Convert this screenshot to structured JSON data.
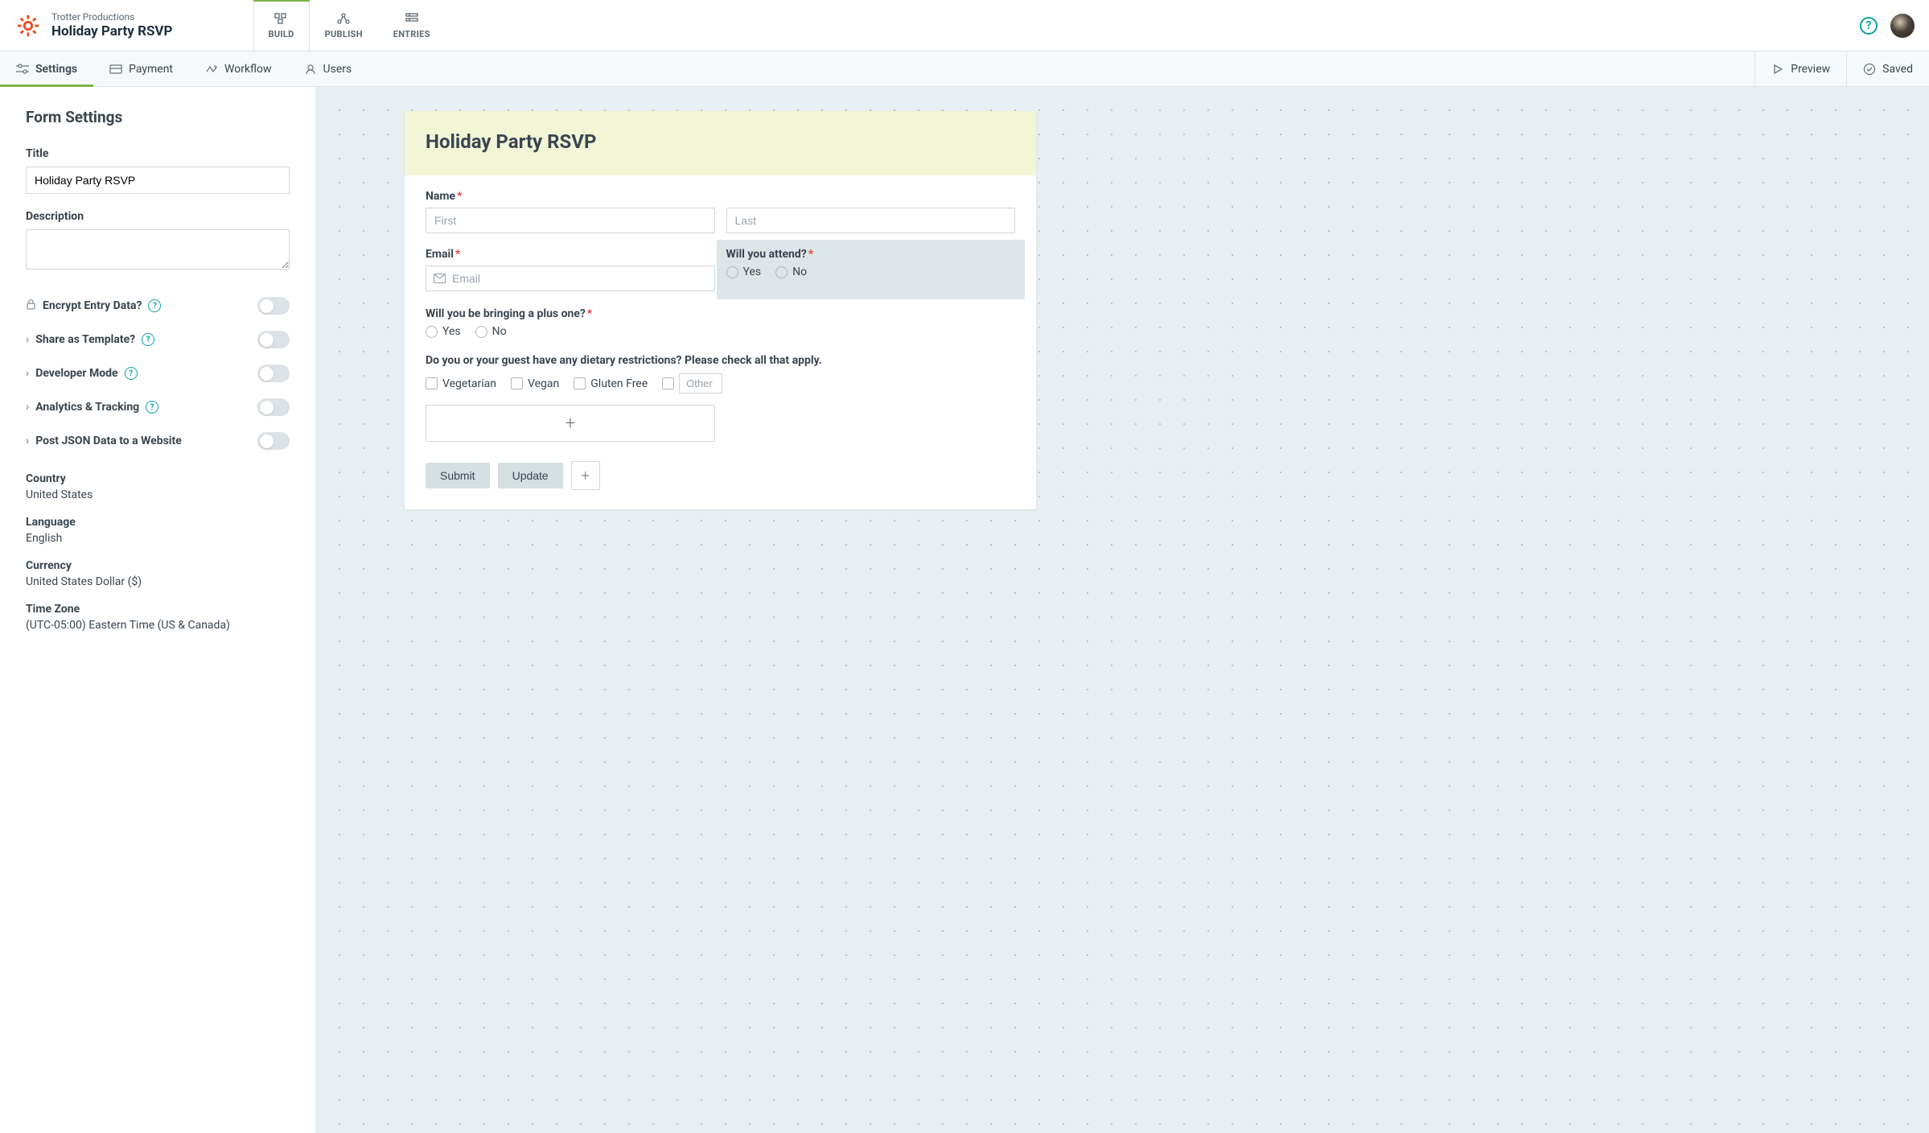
{
  "brand": {
    "org": "Trotter Productions",
    "title": "Holiday Party RSVP"
  },
  "topTabs": {
    "build": "BUILD",
    "publish": "PUBLISH",
    "entries": "ENTRIES"
  },
  "secTabs": {
    "settings": "Settings",
    "payment": "Payment",
    "workflow": "Workflow",
    "users": "Users"
  },
  "secActions": {
    "preview": "Preview",
    "saved": "Saved"
  },
  "sidebar": {
    "heading": "Form Settings",
    "titleLabel": "Title",
    "titleValue": "Holiday Party RSVP",
    "descLabel": "Description",
    "toggles": {
      "encrypt": "Encrypt Entry Data?",
      "template": "Share as Template?",
      "developer": "Developer Mode",
      "analytics": "Analytics & Tracking",
      "postjson": "Post JSON Data to a Website"
    },
    "info": {
      "countryLabel": "Country",
      "countryValue": "United States",
      "languageLabel": "Language",
      "languageValue": "English",
      "currencyLabel": "Currency",
      "currencyValue": "United States Dollar ($)",
      "tzLabel": "Time Zone",
      "tzValue": "(UTC-05:00) Eastern Time (US & Canada)"
    }
  },
  "form": {
    "title": "Holiday Party RSVP",
    "name": {
      "label": "Name",
      "firstPlaceholder": "First",
      "lastPlaceholder": "Last"
    },
    "email": {
      "label": "Email",
      "placeholder": "Email"
    },
    "attend": {
      "label": "Will you attend?",
      "yes": "Yes",
      "no": "No"
    },
    "plusone": {
      "label": "Will you be bringing a plus one?",
      "yes": "Yes",
      "no": "No"
    },
    "dietary": {
      "label": "Do you or your guest have any dietary restrictions? Please check all that apply.",
      "vegetarian": "Vegetarian",
      "vegan": "Vegan",
      "glutenfree": "Gluten Free",
      "otherPlaceholder": "Other"
    },
    "buttons": {
      "submit": "Submit",
      "update": "Update"
    }
  }
}
